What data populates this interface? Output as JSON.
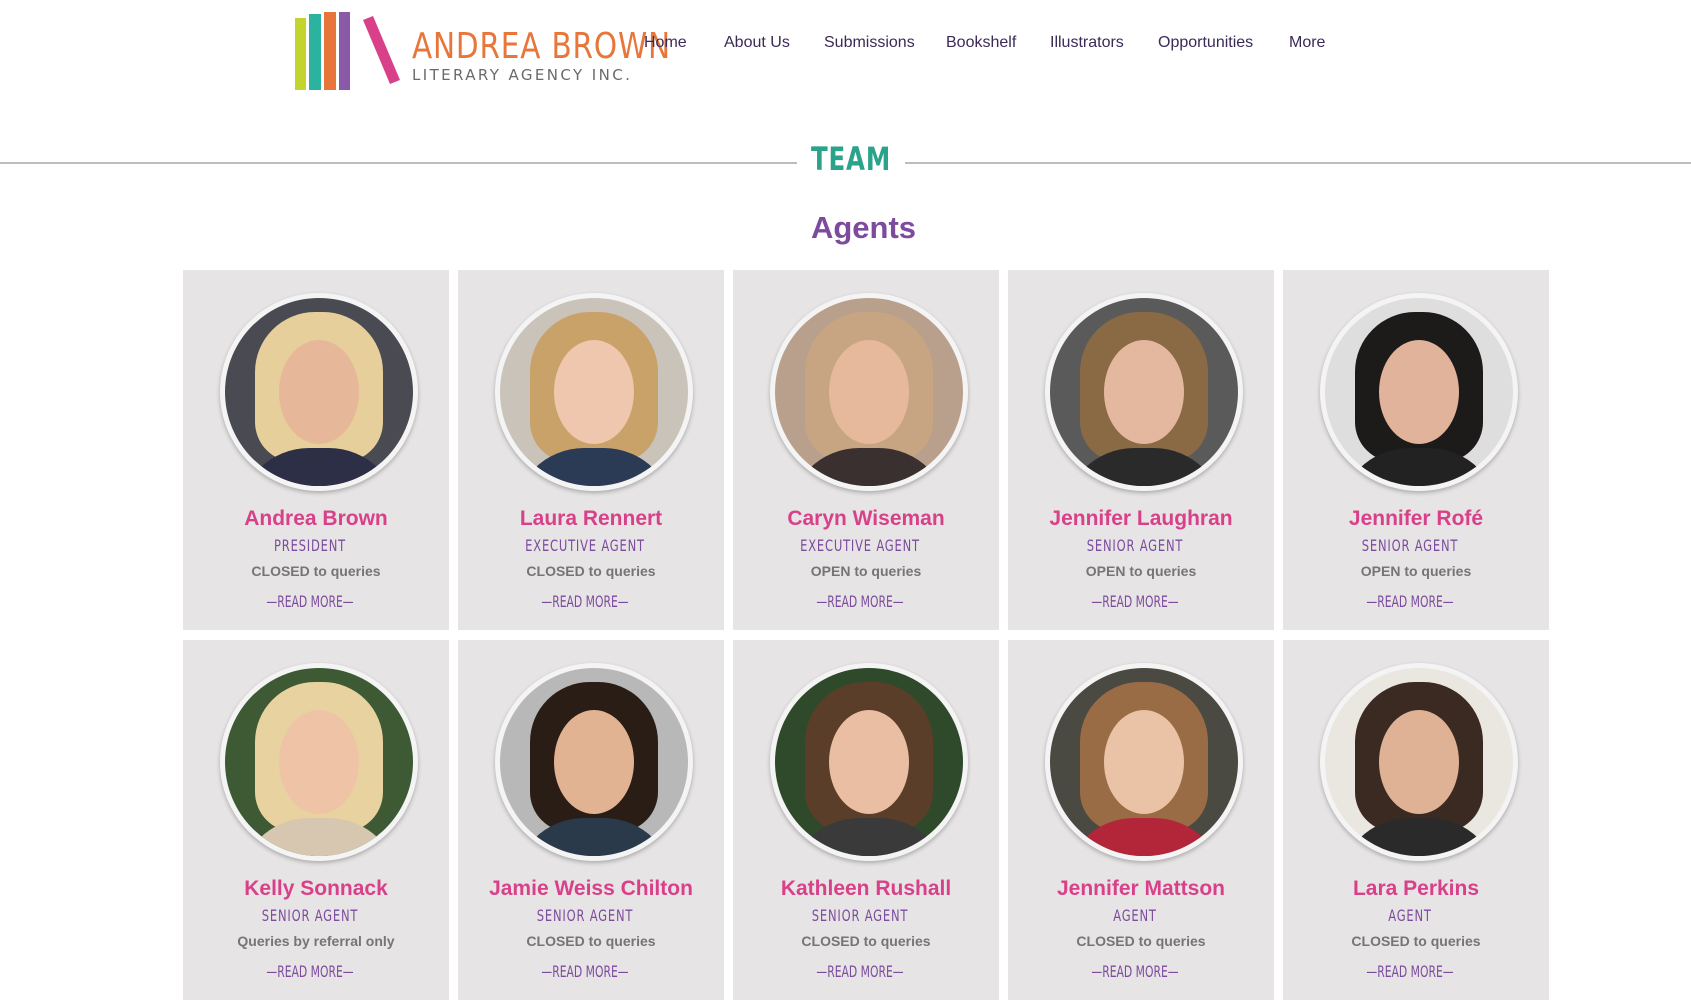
{
  "logo": {
    "name": "ANDREA BROWN",
    "subtitle": "LITERARY AGENCY INC."
  },
  "nav": [
    "Home",
    "About Us",
    "Submissions",
    "Bookshelf",
    "Illustrators",
    "Opportunities",
    "More"
  ],
  "section_title": "TEAM",
  "subsection_title": "Agents",
  "colors": {
    "name": "#d9408a",
    "role": "#7d4b9e",
    "team": "#2aa38a",
    "card": "#e6e4e4"
  },
  "agents": [
    {
      "name": "Andrea Brown",
      "role": "PRESIDENT",
      "status": "CLOSED to queries",
      "read_more": "—READ MORE—"
    },
    {
      "name": "Laura Rennert",
      "role": "EXECUTIVE AGENT",
      "status": "CLOSED to queries",
      "read_more": "—READ MORE—"
    },
    {
      "name": "Caryn Wiseman",
      "role": "EXECUTIVE AGENT",
      "status": "OPEN to queries",
      "read_more": "—READ MORE—"
    },
    {
      "name": "Jennifer Laughran",
      "role": "SENIOR AGENT",
      "status": "OPEN to queries",
      "read_more": "—READ MORE—"
    },
    {
      "name": "Jennifer Rofé",
      "role": "SENIOR AGENT",
      "status": "OPEN to queries",
      "read_more": "—READ MORE—"
    },
    {
      "name": "Kelly Sonnack",
      "role": "SENIOR AGENT",
      "status": "Queries by referral only",
      "read_more": "—READ MORE—"
    },
    {
      "name": "Jamie Weiss Chilton",
      "role": "SENIOR AGENT",
      "status": "CLOSED to queries",
      "read_more": "—READ MORE—"
    },
    {
      "name": "Kathleen Rushall",
      "role": "SENIOR AGENT",
      "status": "CLOSED to queries",
      "read_more": "—READ MORE—"
    },
    {
      "name": "Jennifer Mattson",
      "role": "AGENT",
      "status": "CLOSED to queries",
      "read_more": "—READ MORE—"
    },
    {
      "name": "Lara Perkins",
      "role": "AGENT",
      "status": "CLOSED to queries",
      "read_more": "—READ MORE—"
    }
  ]
}
